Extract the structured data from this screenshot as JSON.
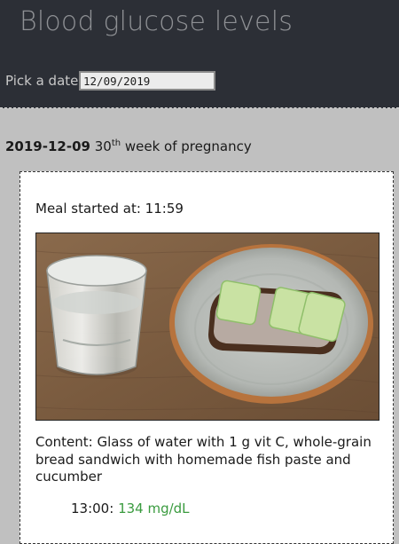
{
  "header": {
    "title": "Blood glucose levels",
    "date_label": "Pick a date:",
    "date_value": "12/09/2019"
  },
  "day": {
    "date": "2019-12-09",
    "week_number": "30",
    "week_suffix": "th",
    "week_text": " week of pregnancy"
  },
  "meal": {
    "started_label": "Meal started at:",
    "started_time": "11:59",
    "content_label": "Content:",
    "content_text": "Glass of water with 1 g vit C, whole-grain bread sandwich with homemade fish paste and cucumber",
    "readings": [
      {
        "time": "13:00",
        "value": "134 mg/dL"
      }
    ]
  },
  "colors": {
    "header_bg": "#2c2f36",
    "page_bg": "#c0c0c0",
    "glucose_ok": "#3a9b3f"
  }
}
